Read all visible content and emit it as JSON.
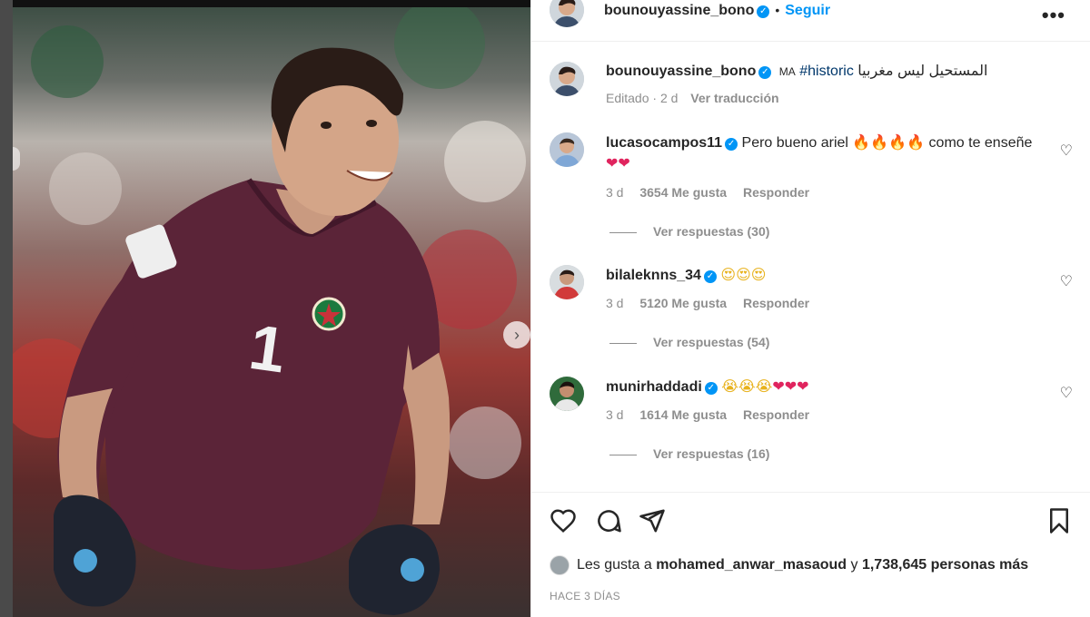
{
  "post": {
    "author": "bounouyassine_bono",
    "follow_label": "Seguir",
    "more_icon": "more-options-icon",
    "dot": "•"
  },
  "caption": {
    "author": "bounouyassine_bono",
    "country_code": "MA",
    "hashtag": "#historic",
    "arabic_text": "المستحيل ليس مغربيا",
    "edited_label": "Editado",
    "age": "2 d",
    "see_translation": "Ver traducción"
  },
  "comments": [
    {
      "username": "lucasocampos11",
      "text_before": "Pero bueno ariel",
      "emoji_main": "🔥🔥🔥🔥",
      "text_after": "como te enseñe",
      "emoji_second": "❤❤",
      "age": "3 d",
      "likes": "3654 Me gusta",
      "reply": "Responder",
      "view_replies": "Ver respuestas (30)"
    },
    {
      "username": "bilaleknns_34",
      "text_before": "",
      "emoji_main": "😍😍😍",
      "text_after": "",
      "emoji_second": "",
      "age": "3 d",
      "likes": "5120 Me gusta",
      "reply": "Responder",
      "view_replies": "Ver respuestas (54)"
    },
    {
      "username": "munirhaddadi",
      "text_before": "",
      "emoji_main": "😭😭😭",
      "text_after": "",
      "emoji_second": "❤❤❤",
      "age": "3 d",
      "likes": "1614 Me gusta",
      "reply": "Responder",
      "view_replies": "Ver respuestas (16)"
    }
  ],
  "footer": {
    "likes_prefix": "Les gusta a",
    "liked_by": "mohamed_anwar_masaoud",
    "likes_joiner": "y",
    "likes_count": "1,738,645 personas más",
    "time_ago": "HACE 3 DÍAS"
  },
  "icons": {
    "like": "heart-icon",
    "comment": "comment-icon",
    "share": "share-icon",
    "save": "bookmark-icon"
  },
  "colors": {
    "accent": "#0095f6",
    "verified": "#0095f6",
    "muted": "#8e8e8e",
    "jersey": "#5b2438"
  }
}
